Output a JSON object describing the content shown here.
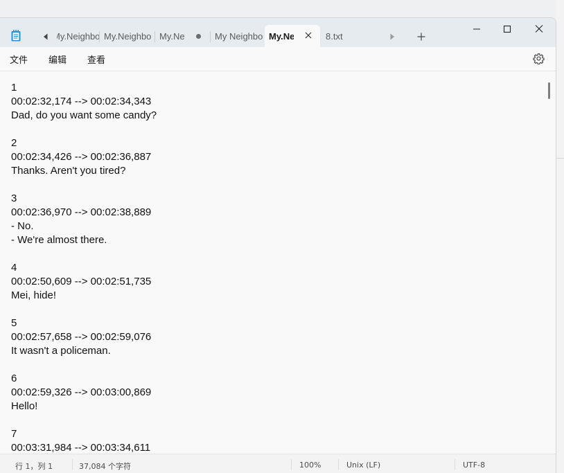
{
  "tabs": [
    {
      "label": "My.Neighbo",
      "truncated_left": true
    },
    {
      "label": "My.Neighbo"
    },
    {
      "label": "My.Ne",
      "modified": true
    },
    {
      "label": "My Neighbo"
    },
    {
      "label": "My.Ne",
      "active": true
    },
    {
      "label": "8.txt"
    }
  ],
  "menu": {
    "file": "文件",
    "edit": "编辑",
    "view": "查看"
  },
  "editor": {
    "lines": [
      "1",
      "00:02:32,174 --> 00:02:34,343",
      "Dad, do you want some candy?",
      "",
      "2",
      "00:02:34,426 --> 00:02:36,887",
      "Thanks. Aren't you tired?",
      "",
      "3",
      "00:02:36,970 --> 00:02:38,889",
      "- No.",
      "- We're almost there.",
      "",
      "4",
      "00:02:50,609 --> 00:02:51,735",
      "Mei, hide!",
      "",
      "5",
      "00:02:57,658 --> 00:02:59,076",
      "It wasn't a policeman.",
      "",
      "6",
      "00:02:59,326 --> 00:03:00,869",
      "Hello!",
      "",
      "7",
      "00:03:31,984 --> 00:03:34,611"
    ]
  },
  "status": {
    "position": "行 1，列 1",
    "char_count": "37,084 个字符",
    "zoom": "100%",
    "line_ending": "Unix (LF)",
    "encoding": "UTF-8"
  },
  "icons": {
    "app": "notepad-icon",
    "scroll_left": "caret-left-icon",
    "scroll_right": "caret-right-icon",
    "new_tab": "plus-icon",
    "settings": "gear-icon",
    "minimize": "minimize-icon",
    "maximize": "maximize-icon",
    "close": "close-icon"
  },
  "colors": {
    "titlebar": "#e5ebef",
    "editor_bg": "#f9f9f9",
    "accent_icon": "#2b8fd6"
  }
}
